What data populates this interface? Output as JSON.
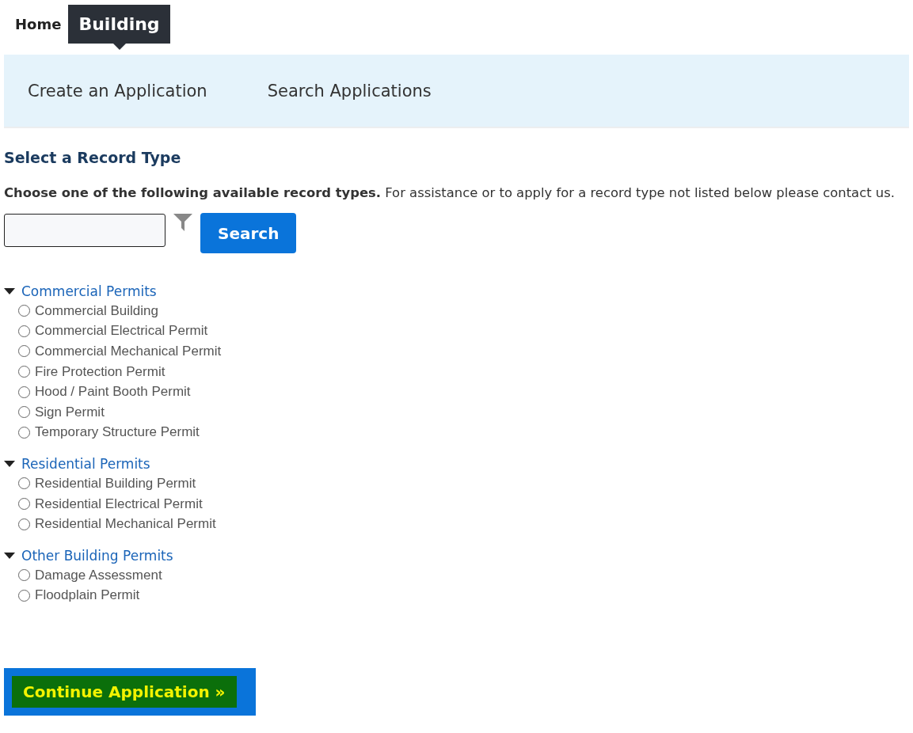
{
  "tabs": [
    {
      "label": "Home",
      "selected": false
    },
    {
      "label": "Building",
      "selected": true
    }
  ],
  "subnav": [
    "Create an Application",
    "Search Applications"
  ],
  "heading": "Select a Record Type",
  "description": "**Choose one of the following available record types.** For assistance or to apply for a record type not listed below please contact us.",
  "search": {
    "button": "Search"
  },
  "groups": [
    {
      "title": "Commercial Permits",
      "expanded": true,
      "items": [
        {
          "label": "Commercial Building",
          "selected": false
        },
        {
          "label": "Commercial Electrical Permit",
          "selected": false
        },
        {
          "label": "Commercial Mechanical Permit",
          "selected": false
        },
        {
          "label": "Fire Protection Permit",
          "selected": false
        },
        {
          "label": "Hood / Paint Booth Permit",
          "selected": false
        },
        {
          "label": "Sign Permit",
          "selected": false
        },
        {
          "label": "Temporary Structure Permit",
          "selected": false
        }
      ]
    },
    {
      "title": "Residential Permits",
      "expanded": true,
      "items": [
        {
          "label": "Residential Building Permit",
          "selected": false
        },
        {
          "label": "Residential Electrical Permit",
          "selected": false
        },
        {
          "label": "Residential Mechanical Permit",
          "selected": false
        }
      ]
    },
    {
      "title": "Other Building Permits",
      "expanded": true,
      "items": [
        {
          "label": "Damage Assessment",
          "selected": false
        },
        {
          "label": "Floodplain Permit",
          "selected": false
        }
      ]
    }
  ],
  "continue_button": "Continue Application »"
}
